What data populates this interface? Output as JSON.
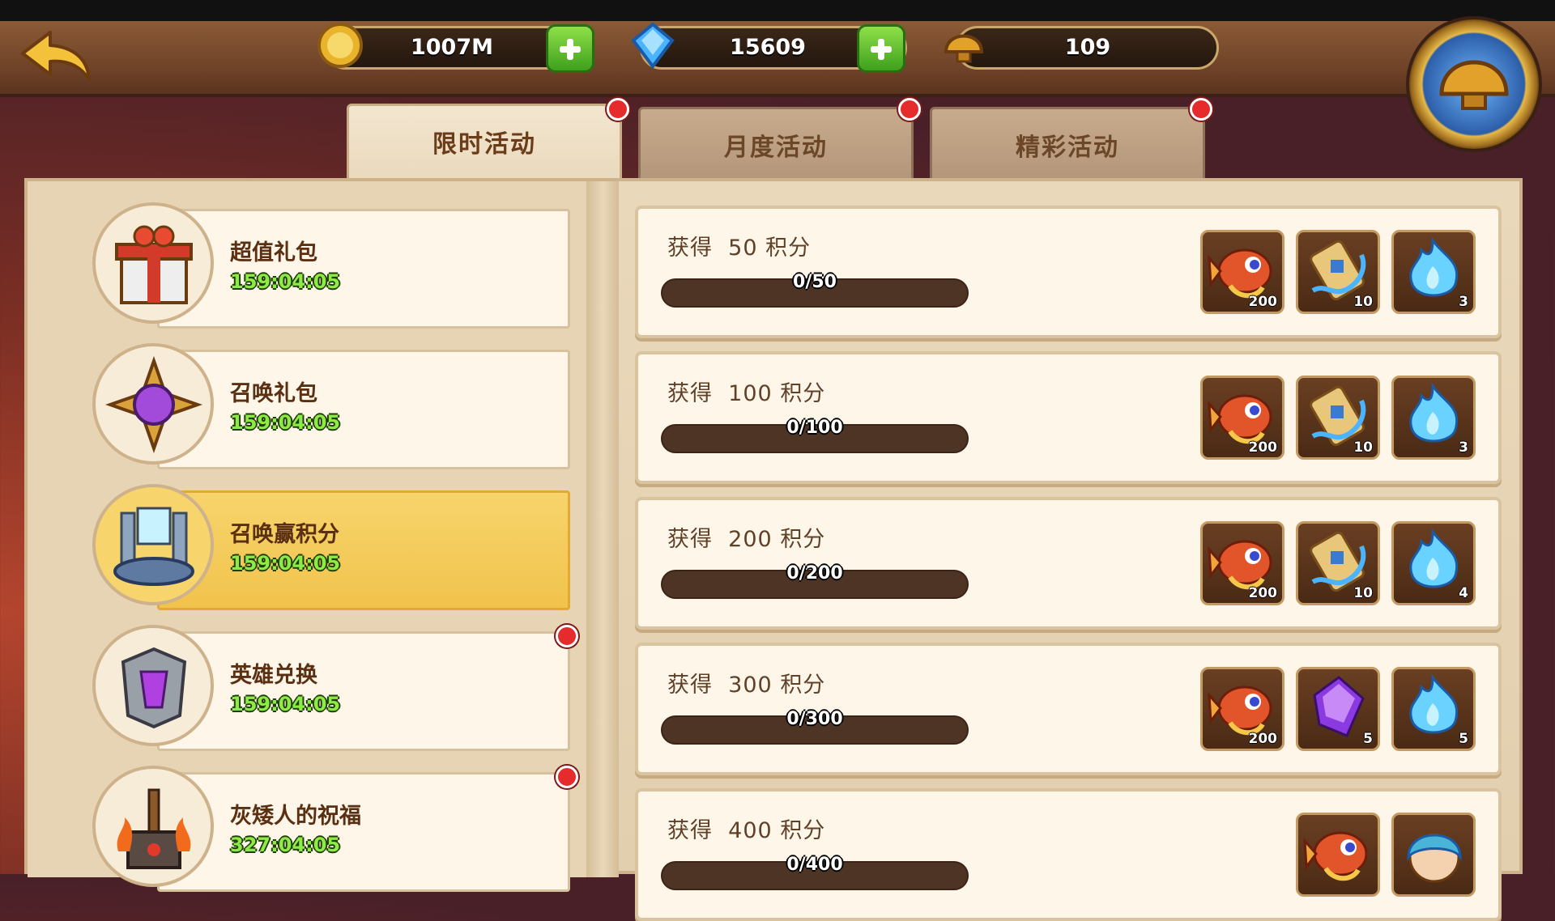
{
  "resources": {
    "gold": {
      "value": "1007M",
      "icon": "gold-coin-icon"
    },
    "gems": {
      "value": "15609",
      "icon": "blue-diamond-icon"
    },
    "spirit": {
      "value": "109",
      "icon": "golden-helmet-icon"
    }
  },
  "tabs": [
    {
      "label": "限时活动",
      "active": true,
      "alert": true
    },
    {
      "label": "月度活动",
      "active": false,
      "alert": true
    },
    {
      "label": "精彩活动",
      "active": false,
      "alert": true
    }
  ],
  "events": [
    {
      "name": "超值礼包",
      "time": "159:04:05",
      "icon": "gift-box-icon",
      "selected": false,
      "alert": false
    },
    {
      "name": "召唤礼包",
      "time": "159:04:05",
      "icon": "summon-star-icon",
      "selected": false,
      "alert": false
    },
    {
      "name": "召唤赢积分",
      "time": "159:04:05",
      "icon": "summon-altar-icon",
      "selected": true,
      "alert": false
    },
    {
      "name": "英雄兑换",
      "time": "159:04:05",
      "icon": "hero-armor-icon",
      "selected": false,
      "alert": true
    },
    {
      "name": "灰矮人的祝福",
      "time": "327:04:05",
      "icon": "dwarf-hammer-icon",
      "selected": false,
      "alert": true
    }
  ],
  "rewards": [
    {
      "prefix": "获得",
      "points": "50",
      "suffix": "积分",
      "progress": "0/50",
      "fraction": 0,
      "items": [
        {
          "icon": "red-fish-icon",
          "count": "200"
        },
        {
          "icon": "scroll-icon",
          "count": "10"
        },
        {
          "icon": "blue-flame-icon",
          "count": "3"
        }
      ]
    },
    {
      "prefix": "获得",
      "points": "100",
      "suffix": "积分",
      "progress": "0/100",
      "fraction": 0,
      "items": [
        {
          "icon": "red-fish-icon",
          "count": "200"
        },
        {
          "icon": "scroll-icon",
          "count": "10"
        },
        {
          "icon": "blue-flame-icon",
          "count": "3"
        }
      ]
    },
    {
      "prefix": "获得",
      "points": "200",
      "suffix": "积分",
      "progress": "0/200",
      "fraction": 0,
      "items": [
        {
          "icon": "red-fish-icon",
          "count": "200"
        },
        {
          "icon": "scroll-icon",
          "count": "10"
        },
        {
          "icon": "blue-flame-icon",
          "count": "4"
        }
      ]
    },
    {
      "prefix": "获得",
      "points": "300",
      "suffix": "积分",
      "progress": "0/300",
      "fraction": 0,
      "items": [
        {
          "icon": "red-fish-icon",
          "count": "200"
        },
        {
          "icon": "purple-gem-icon",
          "count": "5"
        },
        {
          "icon": "blue-flame-icon",
          "count": "5"
        }
      ]
    },
    {
      "prefix": "获得",
      "points": "400",
      "suffix": "积分",
      "progress": "0/400",
      "fraction": 0,
      "items": [
        {
          "icon": "red-fish-icon",
          "count": ""
        },
        {
          "icon": "hero-portrait-icon",
          "count": ""
        }
      ]
    }
  ]
}
